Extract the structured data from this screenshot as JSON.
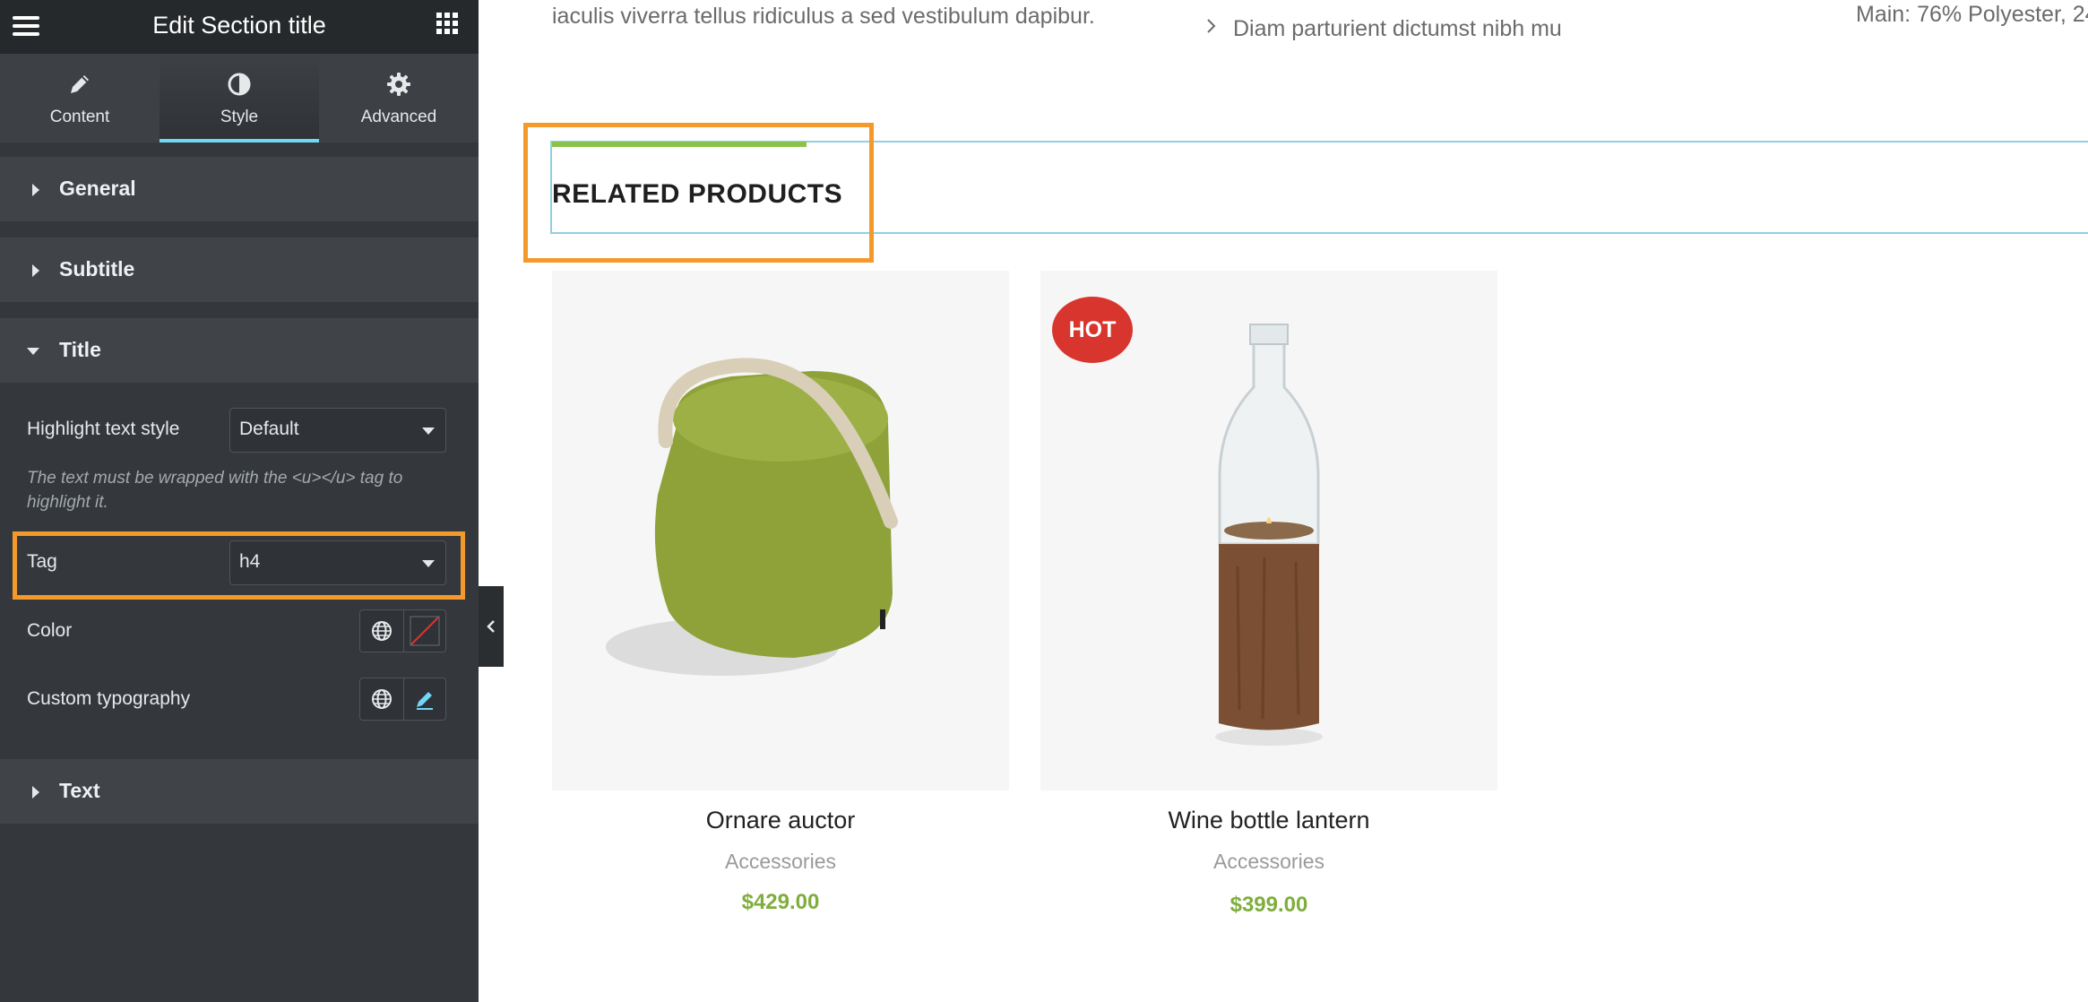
{
  "header": {
    "title": "Edit Section title"
  },
  "tabs": [
    {
      "label": "Content",
      "icon": "pencil-icon"
    },
    {
      "label": "Style",
      "icon": "contrast-icon",
      "active": true
    },
    {
      "label": "Advanced",
      "icon": "gear-icon"
    }
  ],
  "sections": {
    "general": "General",
    "subtitle": "Subtitle",
    "title": "Title",
    "text": "Text"
  },
  "title_controls": {
    "highlight_label": "Highlight text style",
    "highlight_value": "Default",
    "note": "The text must be wrapped with the <u></u> tag to highlight it.",
    "tag_label": "Tag",
    "tag_value": "h4",
    "color_label": "Color",
    "typography_label": "Custom typography"
  },
  "preview": {
    "top_text_left": "iaculis viverra tellus ridiculus a sed vestibulum dapibur.",
    "top_text_mid": "Diam parturient dictumst nibh mu",
    "top_text_right": "Main: 76% Polyester, 24",
    "section_title": "RELATED PRODUCTS",
    "products": [
      {
        "name": "Ornare auctor",
        "category": "Accessories",
        "price": "$429.00",
        "badge": ""
      },
      {
        "name": "Wine bottle lantern",
        "category": "Accessories",
        "price": "$399.00",
        "badge": "HOT"
      }
    ]
  },
  "colors": {
    "panel_bg": "#34383c",
    "accent_blue": "#71d7f7",
    "highlight_orange": "#f39a2b",
    "price_green": "#7fae3c",
    "badge_red": "#d8352e"
  }
}
